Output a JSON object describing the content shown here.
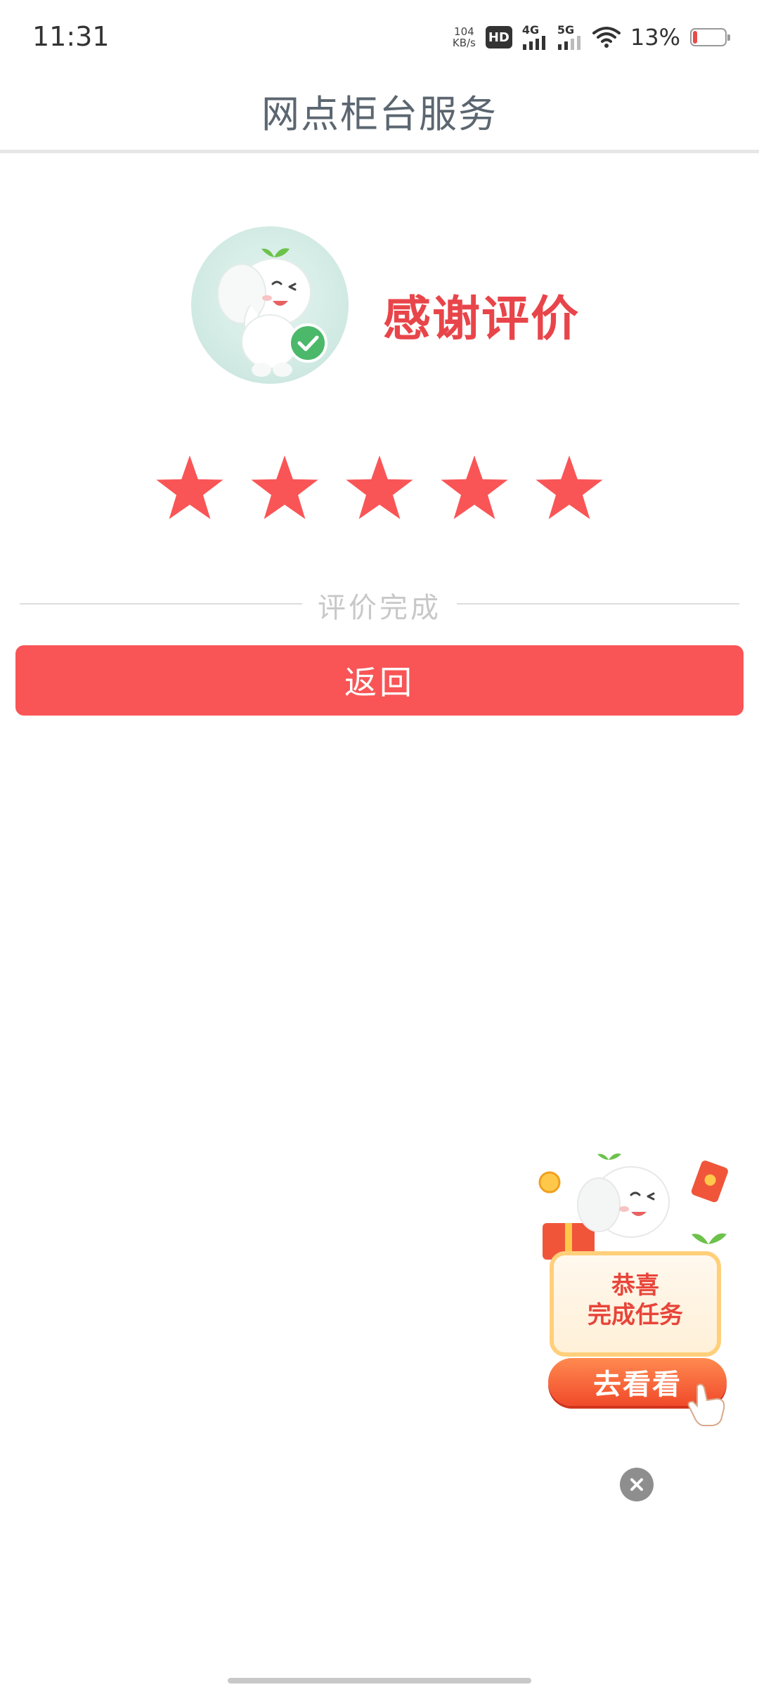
{
  "status_bar": {
    "time": "11:31",
    "net_speed_value": "104",
    "net_speed_unit": "KB/s",
    "hd_label": "HD",
    "sim1_label": "4G",
    "sim2_label": "5G",
    "battery_percent": "13%",
    "battery_level": 0.13,
    "battery_color": "#e84a4a"
  },
  "nav": {
    "title": "网点柜台服务"
  },
  "result": {
    "thanks_text": "感谢评价",
    "rating": 5,
    "max_rating": 5,
    "star_color": "#f95556",
    "completed_text": "评价完成"
  },
  "actions": {
    "back_label": "返回",
    "accent_color": "#f95556"
  },
  "promo": {
    "line1": "恭喜",
    "line2": "完成任务",
    "button_label": "去看看",
    "close_icon": "close-icon"
  },
  "icons": {
    "wifi": "wifi-icon",
    "battery": "battery-icon",
    "check": "check-icon",
    "star": "star-icon",
    "mascot": "elephant-mascot",
    "gift": "gift-icon",
    "pointer": "hand-pointer-icon"
  }
}
